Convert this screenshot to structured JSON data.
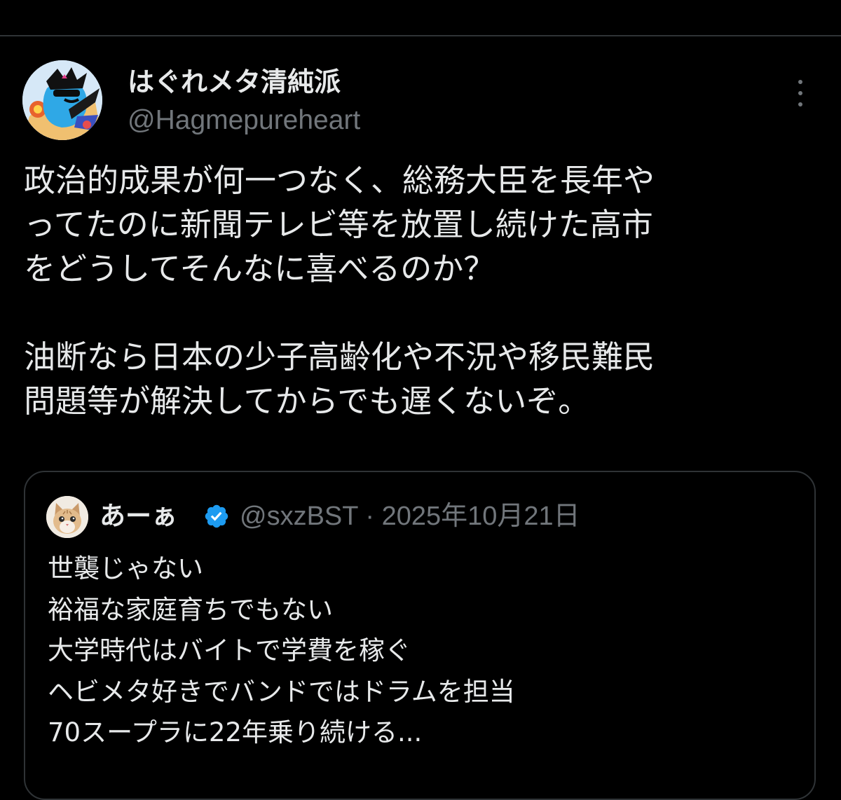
{
  "post": {
    "author": {
      "name": "はぐれメタ清純派",
      "handle": "@Hagmepureheart",
      "avatar_icon": "avatar-cartoon-character"
    },
    "more_icon": "more-options-icon",
    "text_lines": [
      "政治的成果が何一つなく、総務大臣を長年や",
      "ってたのに新聞テレビ等を放置し続けた高市",
      "をどうしてそんなに喜べるのか？",
      "",
      "油断なら日本の少子高齢化や不況や移民難民",
      "問題等が解決してからでも遅くないぞ。"
    ],
    "quote": {
      "author_name": "あーぁ",
      "verified_icon": "verified-badge-icon",
      "handle": "@sxzBST",
      "separator": "·",
      "date": "2025年10月21日",
      "text_lines": [
        "世襲じゃない",
        "裕福な家庭育ちでもない",
        "大学時代はバイトで学費を稼ぐ",
        "ヘビメタ好きでバンドではドラムを担当",
        "70スープラに22年乗り続ける..."
      ]
    }
  },
  "colors": {
    "background": "#000000",
    "text_primary": "#e7e9ea",
    "text_secondary": "#71767b",
    "border": "#2f3336",
    "verified": "#1d9bf0"
  }
}
